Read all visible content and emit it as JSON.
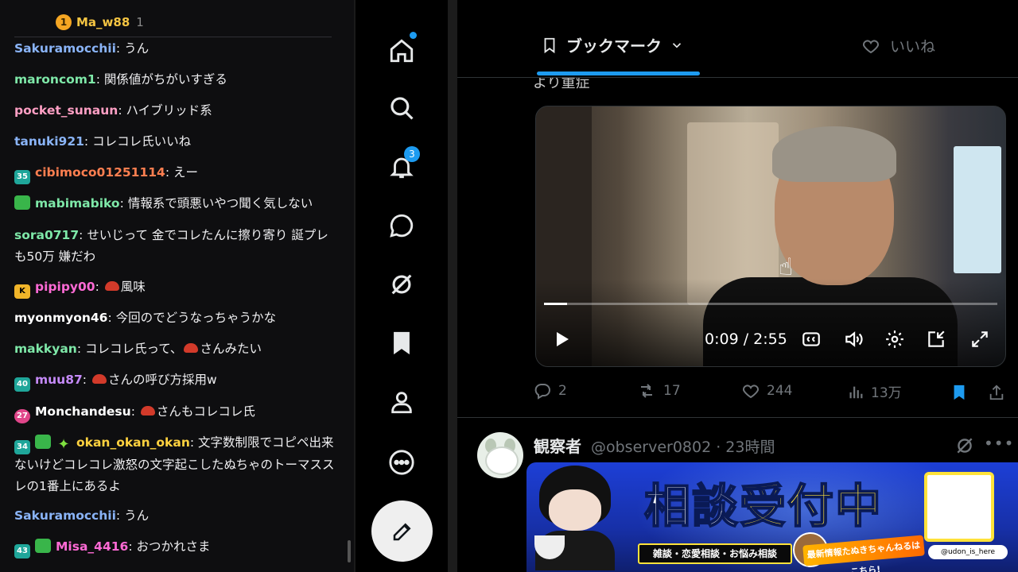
{
  "chat": {
    "top_donor": {
      "rank": "1",
      "name": "Ma_w88",
      "count": "1"
    },
    "messages": [
      {
        "user": "Sakuramocchii",
        "color": "#8ab4f8",
        "text": "うん"
      },
      {
        "user": "maroncom1",
        "color": "#7ee8a8",
        "text": "関係値がちがいすぎる"
      },
      {
        "user": "pocket_sunaun",
        "color": "#ff9fc4",
        "text": "ハイブリッド系"
      },
      {
        "user": "tanuki921",
        "color": "#8ab4f8",
        "text": "コレコレ氏いいね"
      },
      {
        "user": "cibimoco01251114",
        "color": "#ff7f50",
        "badge": "35",
        "text": "えー"
      },
      {
        "user": "mabimabiko",
        "color": "#7ee8a8",
        "text": "情報系で頭悪いやつ聞く気しない"
      },
      {
        "user": "sora0717",
        "color": "#7ee8a8",
        "text": "せいじって 金でコレたんに擦り寄り 誕プレも50万 嫌だわ"
      },
      {
        "user": "pipipy00",
        "color": "#ff6ad5",
        "text": "風味"
      },
      {
        "user": "myonmyon46",
        "color": "#ffffff",
        "text": "今回のでどうなっちゃうかな"
      },
      {
        "user": "makkyan",
        "color": "#7ee8a8",
        "text_pre": "コレコレ氏って、",
        "text": "さんみたい"
      },
      {
        "user": "muu87",
        "color": "#c58af9",
        "badge": "40",
        "text": "さんの呼び方採用w"
      },
      {
        "user": "Monchandesu",
        "color": "#ffffff",
        "badge": "27",
        "text": "さんもコレコレ氏"
      },
      {
        "user": "okan_okan_okan",
        "color": "#ffd23f",
        "badge": "34",
        "text": "文字数制限でコピペ出来ないけどコレコレ激怒の文字起こしたぬちゃのトーマススレの1番上にあるよ"
      },
      {
        "user": "Sakuramocchii",
        "color": "#8ab4f8",
        "text": "うん"
      },
      {
        "user": "Misa_4416",
        "color": "#ff6ad5",
        "badge": "43",
        "text": "おつかれさま"
      }
    ]
  },
  "nav": {
    "notifications_count": "3"
  },
  "feed": {
    "tab_bookmarks": "ブックマーク",
    "tab_likes": "いいね",
    "cut_text": "より重症",
    "video": {
      "time": "0:09 / 2:55",
      "progress": 0.05
    },
    "post1": {
      "replies": "2",
      "reposts": "17",
      "likes": "244",
      "views": "13万"
    },
    "post2": {
      "name": "観察者",
      "handle": "@observer0802 · 23時間"
    }
  },
  "banner": {
    "title_a": "相談",
    "title_b": "受付中",
    "subtitle": "雑談・恋愛相談・お悩み相談",
    "news": "最新情報たぬきちゃんねるはこちら!",
    "x_handle": "@udon_is_here"
  }
}
